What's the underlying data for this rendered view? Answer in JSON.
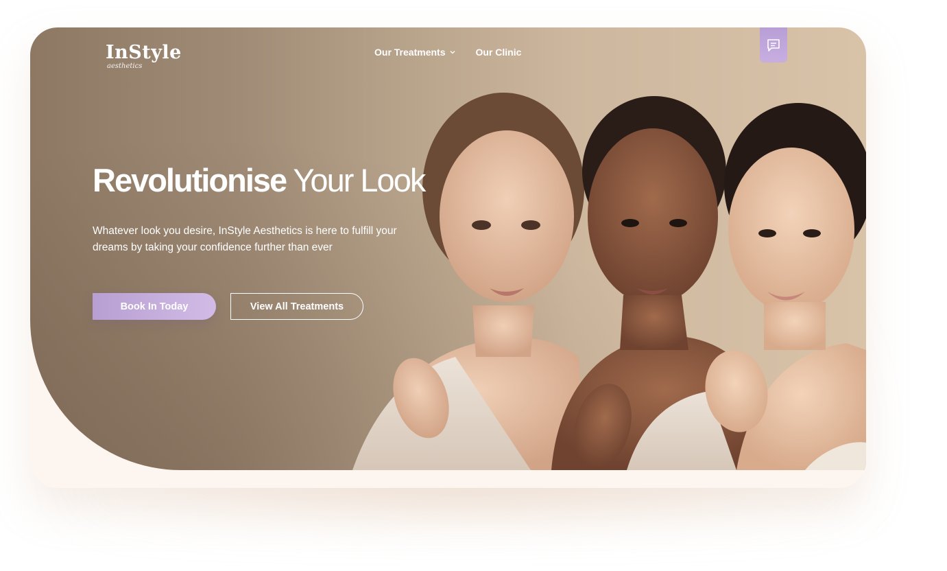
{
  "brand": {
    "name": "InStyle",
    "tagline": "aesthetics"
  },
  "nav": {
    "items": [
      {
        "label": "Our Treatments",
        "has_dropdown": true
      },
      {
        "label": "Our Clinic",
        "has_dropdown": false
      }
    ]
  },
  "chat": {
    "icon": "chat-bubble-icon"
  },
  "hero": {
    "headline_strong": "Revolutionise",
    "headline_light": "Your Look",
    "subtext": "Whatever look you desire, InStyle Aesthetics is here to fulfill your dreams by taking your confidence further than ever",
    "primary_cta": "Book In Today",
    "secondary_cta": "View All Treatments",
    "image": "three-models-portrait"
  },
  "colors": {
    "accent": "#b79fd2",
    "hero_bg_dark": "#8d7864",
    "hero_bg_light": "#d8c3a9",
    "text": "#ffffff"
  }
}
